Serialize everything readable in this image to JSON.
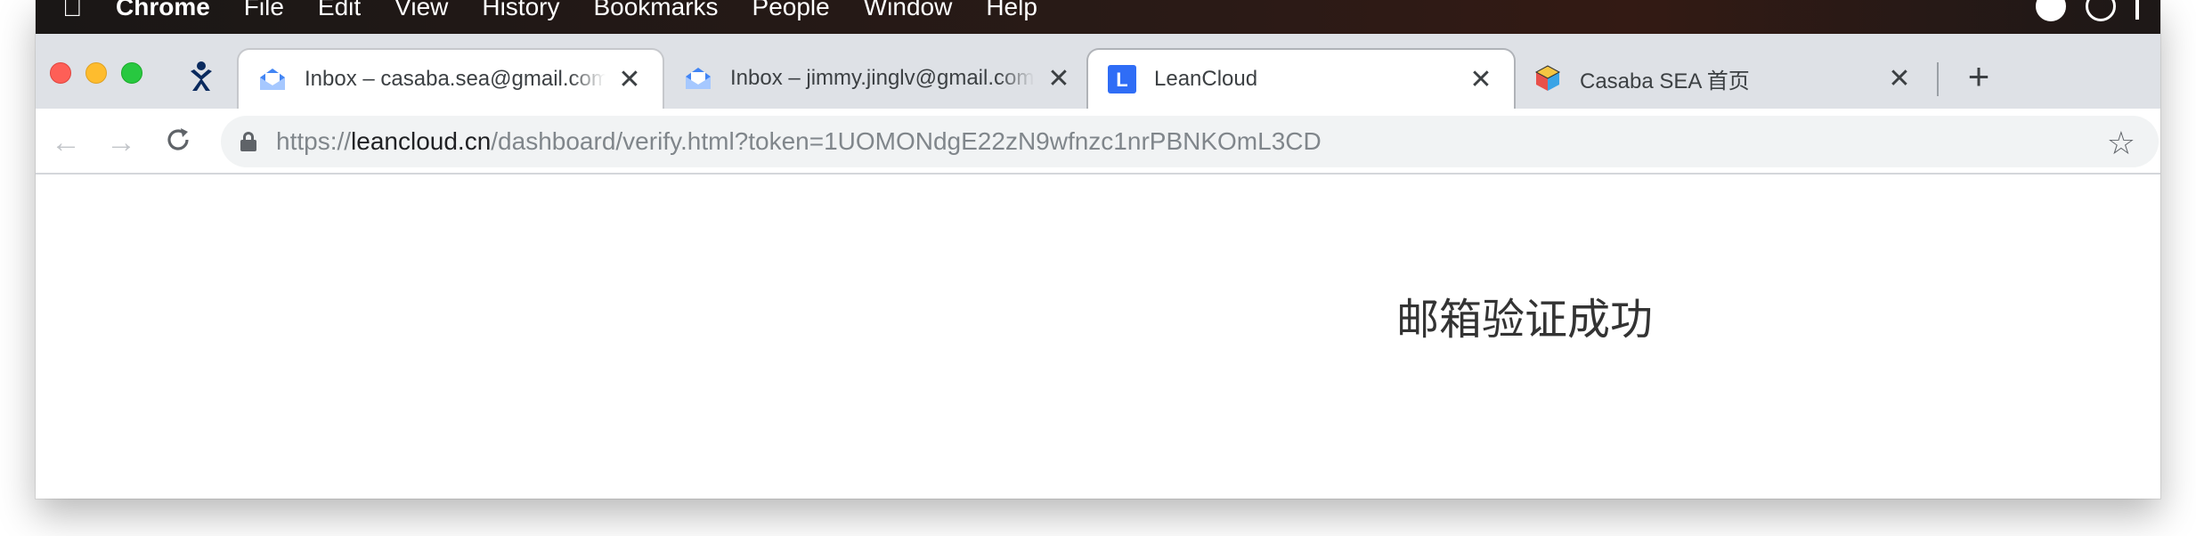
{
  "menubar": {
    "items": [
      "Chrome",
      "File",
      "Edit",
      "View",
      "History",
      "Bookmarks",
      "People",
      "Window",
      "Help"
    ]
  },
  "tabs": [
    {
      "title": "Inbox – casaba.sea@gmail.com",
      "favicon": "inbox-icon",
      "state": "background"
    },
    {
      "title": "Inbox – jimmy.jinglv@gmail.com",
      "favicon": "inbox-icon",
      "state": "background"
    },
    {
      "title": "LeanCloud",
      "favicon": "leancloud-icon",
      "favicon_letter": "L",
      "state": "active"
    },
    {
      "title": "Casaba SEA 首页",
      "favicon": "cube-icon",
      "state": "background"
    }
  ],
  "toolbar": {
    "url_scheme": "https://",
    "url_host": "leancloud.cn",
    "url_path": "/dashboard/verify.html?token=1UOMONdgE22zN9wfnzc1nrPBNKOmL3CD"
  },
  "page": {
    "message": "邮箱验证成功"
  },
  "colors": {
    "tab_strip": "#dee1e6",
    "leancloud_blue": "#2f6df6",
    "inbox_blue": "#4285f4"
  }
}
